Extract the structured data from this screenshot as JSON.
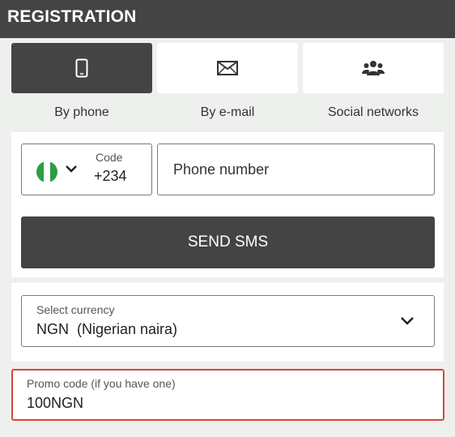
{
  "header": {
    "title": "REGISTRATION"
  },
  "tabs": [
    {
      "label": "By phone",
      "icon": "smartphone-icon",
      "active": true
    },
    {
      "label": "By e-mail",
      "icon": "envelope-icon",
      "active": false
    },
    {
      "label": "Social networks",
      "icon": "people-icon",
      "active": false
    }
  ],
  "phone_form": {
    "country_flag": "nigeria-flag-icon",
    "code_label": "Code",
    "code_value": "+234",
    "phone_placeholder": "Phone number",
    "send_button_label": "SEND SMS"
  },
  "currency": {
    "label": "Select currency",
    "value": "NGN  (Nigerian naira)"
  },
  "promo": {
    "label": "Promo code (if you have one)",
    "value": "100NGN"
  },
  "colors": {
    "dark": "#444444",
    "background": "#eef0ee",
    "error_border": "#d6463c",
    "flag_green": "#2a9d45"
  }
}
